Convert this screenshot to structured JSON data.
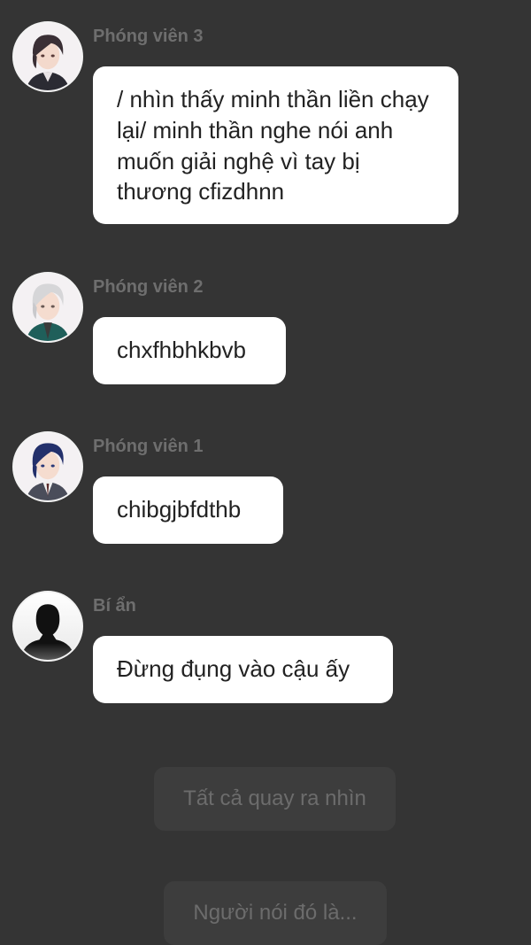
{
  "messages": [
    {
      "sender": "Phóng viên 3",
      "avatar_icon": "reporter-3-portrait-icon",
      "text": "/ nhìn thấy minh thần liền chạy lại/ minh thần nghe nói anh muốn giải nghệ vì tay bị thương cfizdhnn"
    },
    {
      "sender": "Phóng viên 2",
      "avatar_icon": "reporter-2-portrait-icon",
      "text": "chxfhbhkbvb"
    },
    {
      "sender": "Phóng viên 1",
      "avatar_icon": "reporter-1-portrait-icon",
      "text": "chibgjbfdthb"
    },
    {
      "sender": "Bí ẩn",
      "avatar_icon": "silhouette-icon",
      "text": "Đừng đụng vào cậu ấy"
    }
  ],
  "choices": [
    {
      "label": "Tất cả quay ra nhìn"
    },
    {
      "label": "Người nói đó là..."
    }
  ],
  "colors": {
    "background": "#343434",
    "bubble": "#ffffff",
    "sender_name": "#6e6e6e",
    "choice_bg": "#3d3d3d",
    "choice_text": "#6c6c6c"
  }
}
